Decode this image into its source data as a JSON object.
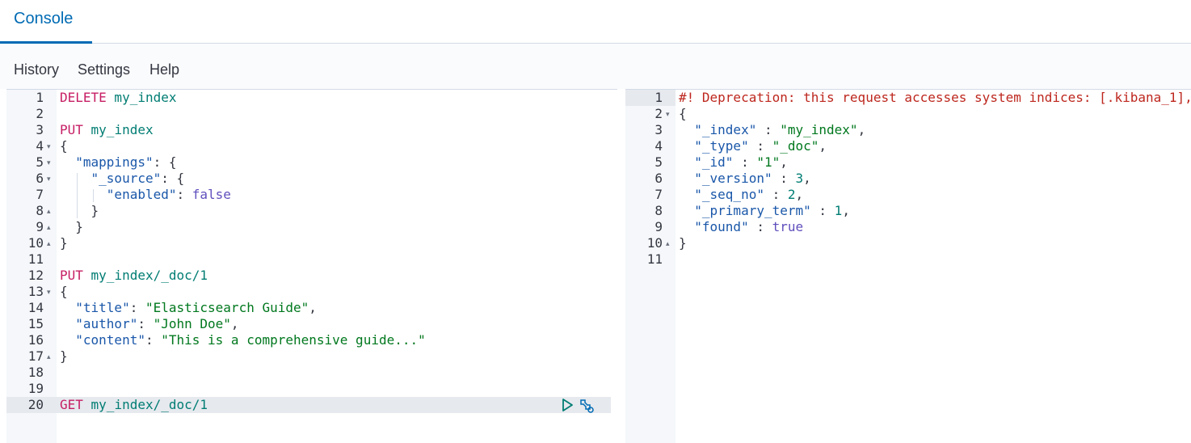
{
  "tabs": [
    {
      "label": "Console"
    }
  ],
  "menu": {
    "history": "History",
    "settings": "Settings",
    "help": "Help"
  },
  "request": {
    "line_numbers": [
      "1",
      "2",
      "3",
      "4",
      "5",
      "6",
      "7",
      "8",
      "9",
      "10",
      "11",
      "12",
      "13",
      "14",
      "15",
      "16",
      "17",
      "18",
      "19",
      "20"
    ],
    "lines": [
      [
        {
          "t": "DELETE",
          "c": "kw-put"
        },
        {
          "t": " my_index",
          "c": "url"
        }
      ],
      [],
      [
        {
          "t": "PUT",
          "c": "kw-put"
        },
        {
          "t": " my_index",
          "c": "url"
        }
      ],
      [
        {
          "t": "{",
          "c": "punc"
        }
      ],
      [
        {
          "t": "  ",
          "c": "punc"
        },
        {
          "t": "\"mappings\"",
          "c": "key"
        },
        {
          "t": ": {",
          "c": "punc"
        }
      ],
      [
        {
          "t": "    ",
          "c": "punc"
        },
        {
          "t": "\"_source\"",
          "c": "key"
        },
        {
          "t": ": {",
          "c": "punc"
        }
      ],
      [
        {
          "t": "      ",
          "c": "punc"
        },
        {
          "t": "\"enabled\"",
          "c": "key"
        },
        {
          "t": ": ",
          "c": "punc"
        },
        {
          "t": "false",
          "c": "kbool"
        }
      ],
      [
        {
          "t": "    }",
          "c": "punc"
        }
      ],
      [
        {
          "t": "  }",
          "c": "punc"
        }
      ],
      [
        {
          "t": "}",
          "c": "punc"
        }
      ],
      [],
      [
        {
          "t": "PUT",
          "c": "kw-put"
        },
        {
          "t": " my_index/_doc/1",
          "c": "url"
        }
      ],
      [
        {
          "t": "{",
          "c": "punc"
        }
      ],
      [
        {
          "t": "  ",
          "c": "punc"
        },
        {
          "t": "\"title\"",
          "c": "key"
        },
        {
          "t": ": ",
          "c": "punc"
        },
        {
          "t": "\"Elasticsearch Guide\"",
          "c": "str"
        },
        {
          "t": ",",
          "c": "punc"
        }
      ],
      [
        {
          "t": "  ",
          "c": "punc"
        },
        {
          "t": "\"author\"",
          "c": "key"
        },
        {
          "t": ": ",
          "c": "punc"
        },
        {
          "t": "\"John Doe\"",
          "c": "str"
        },
        {
          "t": ",",
          "c": "punc"
        }
      ],
      [
        {
          "t": "  ",
          "c": "punc"
        },
        {
          "t": "\"content\"",
          "c": "key"
        },
        {
          "t": ": ",
          "c": "punc"
        },
        {
          "t": "\"This is a comprehensive guide...\"",
          "c": "str"
        }
      ],
      [
        {
          "t": "}",
          "c": "punc"
        }
      ],
      [],
      [],
      [
        {
          "t": "GET",
          "c": "kw-put"
        },
        {
          "t": " my_index/_doc/1",
          "c": "url"
        }
      ]
    ],
    "folds": {
      "4": "▾",
      "5": "▾",
      "6": "▾",
      "8": "▴",
      "9": "▴",
      "10": "▴",
      "13": "▾",
      "17": "▴"
    },
    "active_line": "20"
  },
  "response": {
    "line_numbers": [
      "1",
      "2",
      "3",
      "4",
      "5",
      "6",
      "7",
      "8",
      "9",
      "10",
      "11"
    ],
    "lines": [
      [
        {
          "t": "#! Deprecation: this request accesses system indices: [.kibana_1],",
          "c": "warn"
        }
      ],
      [
        {
          "t": "{",
          "c": "punc"
        }
      ],
      [
        {
          "t": "  ",
          "c": "punc"
        },
        {
          "t": "\"_index\"",
          "c": "key"
        },
        {
          "t": " : ",
          "c": "punc"
        },
        {
          "t": "\"my_index\"",
          "c": "str"
        },
        {
          "t": ",",
          "c": "punc"
        }
      ],
      [
        {
          "t": "  ",
          "c": "punc"
        },
        {
          "t": "\"_type\"",
          "c": "key"
        },
        {
          "t": " : ",
          "c": "punc"
        },
        {
          "t": "\"_doc\"",
          "c": "str"
        },
        {
          "t": ",",
          "c": "punc"
        }
      ],
      [
        {
          "t": "  ",
          "c": "punc"
        },
        {
          "t": "\"_id\"",
          "c": "key"
        },
        {
          "t": " : ",
          "c": "punc"
        },
        {
          "t": "\"1\"",
          "c": "str"
        },
        {
          "t": ",",
          "c": "punc"
        }
      ],
      [
        {
          "t": "  ",
          "c": "punc"
        },
        {
          "t": "\"_version\"",
          "c": "key"
        },
        {
          "t": " : ",
          "c": "punc"
        },
        {
          "t": "3",
          "c": "num"
        },
        {
          "t": ",",
          "c": "punc"
        }
      ],
      [
        {
          "t": "  ",
          "c": "punc"
        },
        {
          "t": "\"_seq_no\"",
          "c": "key"
        },
        {
          "t": " : ",
          "c": "punc"
        },
        {
          "t": "2",
          "c": "num"
        },
        {
          "t": ",",
          "c": "punc"
        }
      ],
      [
        {
          "t": "  ",
          "c": "punc"
        },
        {
          "t": "\"_primary_term\"",
          "c": "key"
        },
        {
          "t": " : ",
          "c": "punc"
        },
        {
          "t": "1",
          "c": "num"
        },
        {
          "t": ",",
          "c": "punc"
        }
      ],
      [
        {
          "t": "  ",
          "c": "punc"
        },
        {
          "t": "\"found\"",
          "c": "key"
        },
        {
          "t": " : ",
          "c": "punc"
        },
        {
          "t": "true",
          "c": "kbool"
        }
      ],
      [
        {
          "t": "}",
          "c": "punc"
        }
      ],
      []
    ],
    "folds": {
      "2": "▾",
      "10": "▴"
    },
    "active_line": "1"
  },
  "icons": {
    "play": "play-icon",
    "wrench": "wrench-icon"
  },
  "colors": {
    "accent": "#006bb4",
    "active_line_bg": "#e6e9ee",
    "gutter_bg": "#f5f7fa"
  }
}
